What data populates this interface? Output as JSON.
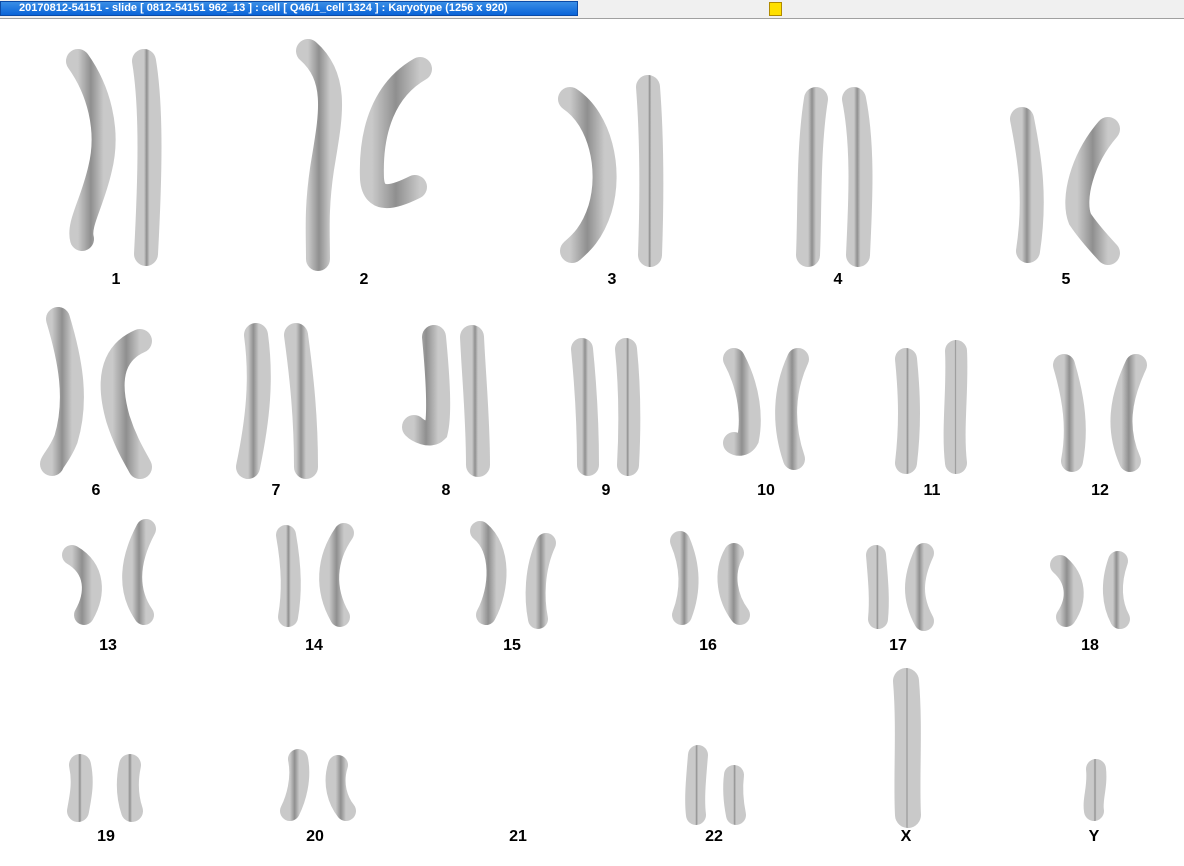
{
  "window": {
    "title": "20170812-54151 - slide [ 0812-54151 962_13 ] : cell [ Q46/1_cell 1324 ] : Karyotype  (1256 x 920)",
    "status_color": "#ffe000"
  },
  "karyotype": {
    "chromosomes": [
      {
        "id": "chr-1",
        "label": "1"
      },
      {
        "id": "chr-2",
        "label": "2"
      },
      {
        "id": "chr-3",
        "label": "3"
      },
      {
        "id": "chr-4",
        "label": "4"
      },
      {
        "id": "chr-5",
        "label": "5"
      },
      {
        "id": "chr-6",
        "label": "6"
      },
      {
        "id": "chr-7",
        "label": "7"
      },
      {
        "id": "chr-8",
        "label": "8"
      },
      {
        "id": "chr-9",
        "label": "9"
      },
      {
        "id": "chr-10",
        "label": "10"
      },
      {
        "id": "chr-11",
        "label": "11"
      },
      {
        "id": "chr-12",
        "label": "12"
      },
      {
        "id": "chr-13",
        "label": "13"
      },
      {
        "id": "chr-14",
        "label": "14"
      },
      {
        "id": "chr-15",
        "label": "15"
      },
      {
        "id": "chr-16",
        "label": "16"
      },
      {
        "id": "chr-17",
        "label": "17"
      },
      {
        "id": "chr-18",
        "label": "18"
      },
      {
        "id": "chr-19",
        "label": "19"
      },
      {
        "id": "chr-20",
        "label": "20"
      },
      {
        "id": "chr-21",
        "label": "21"
      },
      {
        "id": "chr-22",
        "label": "22"
      },
      {
        "id": "chr-x",
        "label": "X"
      },
      {
        "id": "chr-y",
        "label": "Y"
      }
    ]
  }
}
